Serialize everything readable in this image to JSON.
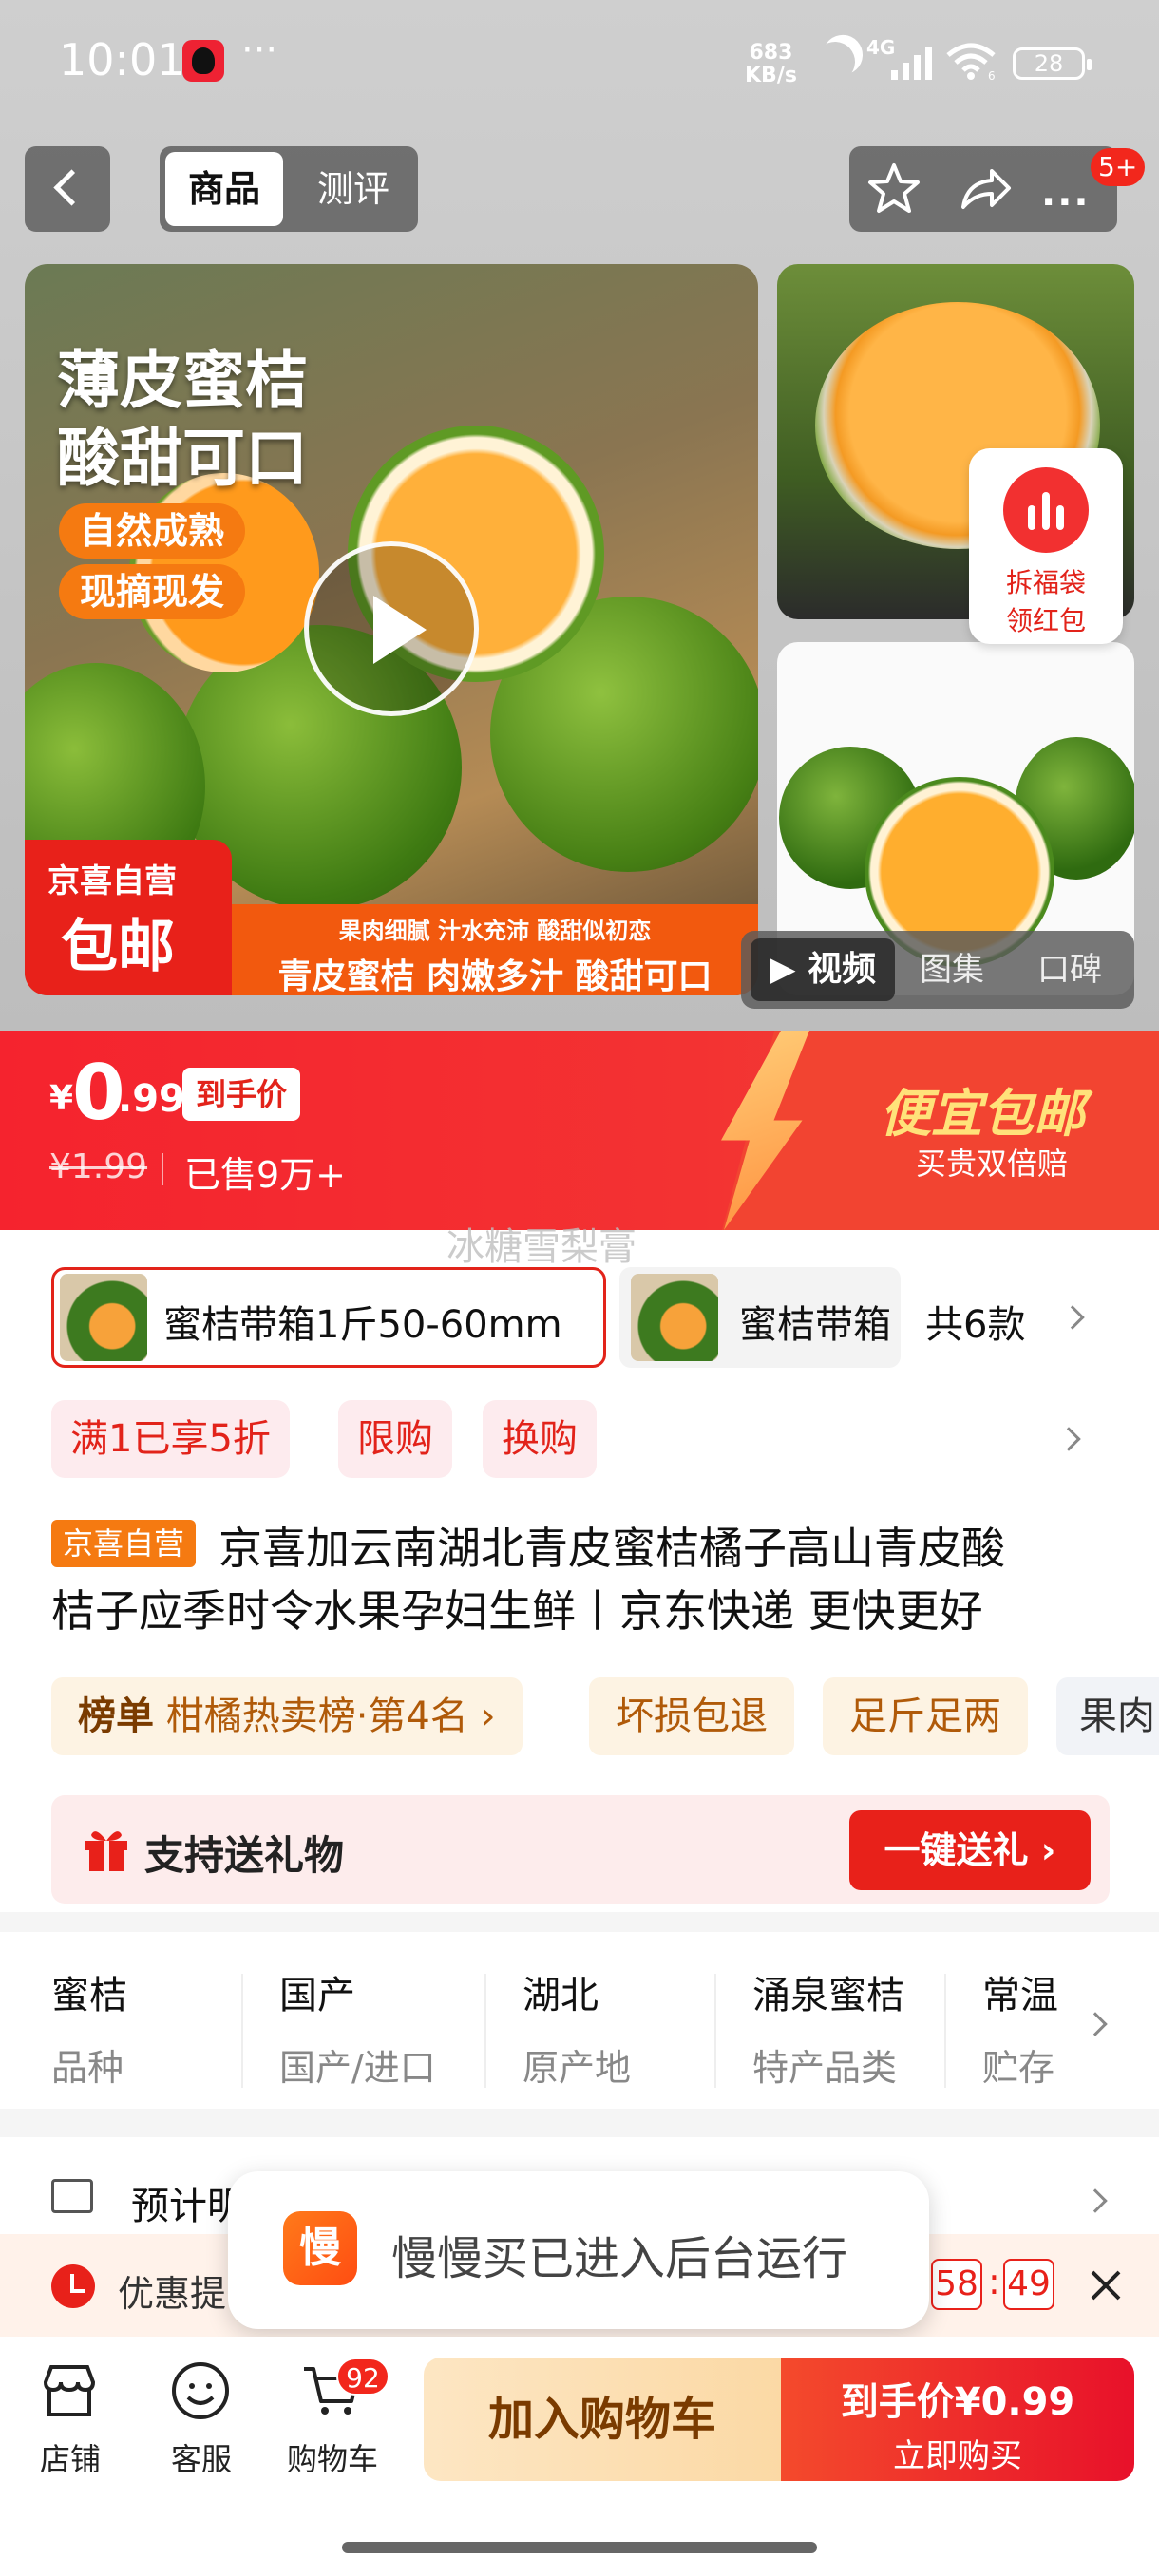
{
  "status_bar": {
    "time": "10:01",
    "ellipsis": "···",
    "net_speed_value": "683",
    "net_speed_unit": "KB/s",
    "network": "4G",
    "wifi_num": "6",
    "battery": "28"
  },
  "nav": {
    "tabs": [
      "商品",
      "测评"
    ],
    "more": "···",
    "message_count": "5+"
  },
  "gallery": {
    "headline_1": "薄皮蜜桔",
    "headline_2": "酸甜可口",
    "pill_1": "自然成熟",
    "pill_2": "现摘现发",
    "badge_line1": "京喜自营",
    "badge_line2": "包邮",
    "strip_line1": "果肉细腻 汁水充沛 酸甜似初恋",
    "strip_line2": "青皮蜜桔 肉嫩多汁 酸甜可口",
    "media_tabs": [
      "视频",
      "图集",
      "口碑"
    ],
    "redpack_line1": "拆福袋",
    "redpack_line2": "领红包"
  },
  "price": {
    "symbol": "¥",
    "integer": "0",
    "decimal": ".99",
    "tag": "到手价",
    "original": "¥1.99",
    "sold": "已售9万+",
    "promo_title": "便宜包邮",
    "promo_sub": "买贵双倍赔"
  },
  "watermark": "冰糖雪梨膏",
  "sku": {
    "selected": "蜜桔带箱1斤50-60mm",
    "other": "蜜桔带箱",
    "count": "共6款"
  },
  "promo_tags": [
    "满1已享5折",
    "限购",
    "换购"
  ],
  "product": {
    "badge": "京喜自营",
    "title_line1": "京喜加云南湖北青皮蜜桔橘子高山青皮酸",
    "title_line2": "桔子应季时令水果孕妇生鲜丨京东快递 更快更好"
  },
  "chips": {
    "rank_label": "榜单",
    "rank_text": "柑橘热卖榜·第4名",
    "rank_arrow": "›",
    "items": [
      "坏损包退",
      "足斤足两",
      "果肉"
    ]
  },
  "gift": {
    "text": "支持送礼物",
    "button": "一键送礼 ›"
  },
  "attributes": [
    {
      "value": "蜜桔",
      "key": "品种"
    },
    {
      "value": "国产",
      "key": "国产/进口"
    },
    {
      "value": "湖北",
      "key": "原产地"
    },
    {
      "value": "涌泉蜜桔",
      "key": "特产品类"
    },
    {
      "value": "常温",
      "key": "贮存"
    }
  ],
  "delivery": {
    "text": "预计明"
  },
  "coupon_bar": {
    "text": "优惠提",
    "min": "58",
    "colon": ":",
    "sec": "49"
  },
  "toast": {
    "icon_char": "慢",
    "text": "慢慢买已进入后台运行"
  },
  "bottom_bar": {
    "store": "店铺",
    "service": "客服",
    "cart": "购物车",
    "cart_count": "92",
    "add_to_cart": "加入购物车",
    "buy_line1": "到手价¥0.99",
    "buy_line2": "立即购买"
  }
}
